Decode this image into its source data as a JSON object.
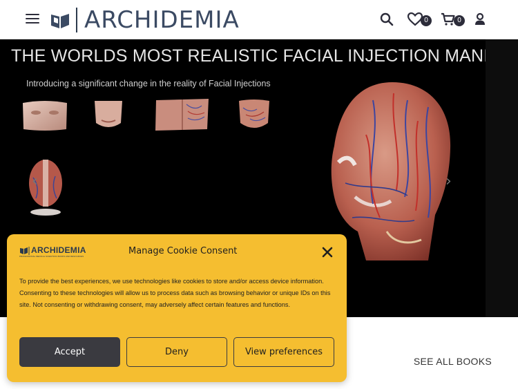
{
  "header": {
    "logo_text": "ARCHIDEMIA",
    "wishlist_count": "0",
    "cart_count": "0",
    "icons": [
      "menu-icon",
      "search-icon",
      "heart-icon",
      "cart-icon",
      "user-icon"
    ]
  },
  "hero": {
    "title": "THE WORLDS MOST REALISTIC FACIAL INJECTION MANIKINS™",
    "subtitle": "Introducing a significant change in the reality of Facial Injections",
    "prev_arrow": "‹",
    "next_arrow": "›"
  },
  "section": {
    "see_all_label": "SEE ALL BOOKS"
  },
  "cookie": {
    "logo_text": "ARCHIDEMIA",
    "logo_tagline": "PROFESSIONAL MEDICAL SCIENTIFIC BOOKS AND RESOURCES",
    "title": "Manage Cookie Consent",
    "body": "To provide the best experiences, we use technologies like cookies to store and/or access device information. Consenting to these technologies will allow us to process data such as browsing behavior or unique IDs on this site. Not consenting or withdrawing consent, may adversely affect certain features and functions.",
    "accept_label": "Accept",
    "deny_label": "Deny",
    "prefs_label": "View preferences"
  },
  "colors": {
    "accent": "#f5be30",
    "dark": "#3a3a40",
    "hero_bg": "#000000"
  }
}
